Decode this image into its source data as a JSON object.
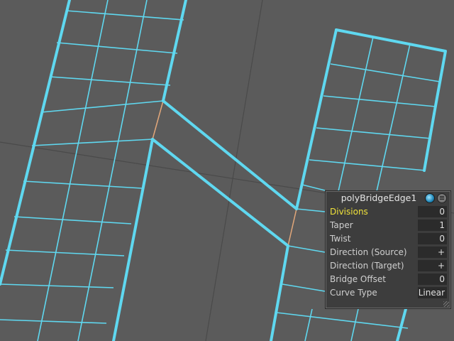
{
  "viewport": {
    "background": "#5b5b5b",
    "wire_color": "#5fd8f0",
    "bridge_edge_color": "#e2a77a"
  },
  "hud": {
    "title": "polyBridgeEdge1",
    "icons": [
      "globe-icon",
      "menu-icon"
    ],
    "rows": [
      {
        "label": "Divisions",
        "value": "0",
        "active": true
      },
      {
        "label": "Taper",
        "value": "1"
      },
      {
        "label": "Twist",
        "value": "0"
      },
      {
        "label": "Direction (Source)",
        "value": "+"
      },
      {
        "label": "Direction (Target)",
        "value": "+"
      },
      {
        "label": "Bridge Offset",
        "value": "0"
      },
      {
        "label": "Curve Type",
        "value": "Linear"
      }
    ]
  }
}
